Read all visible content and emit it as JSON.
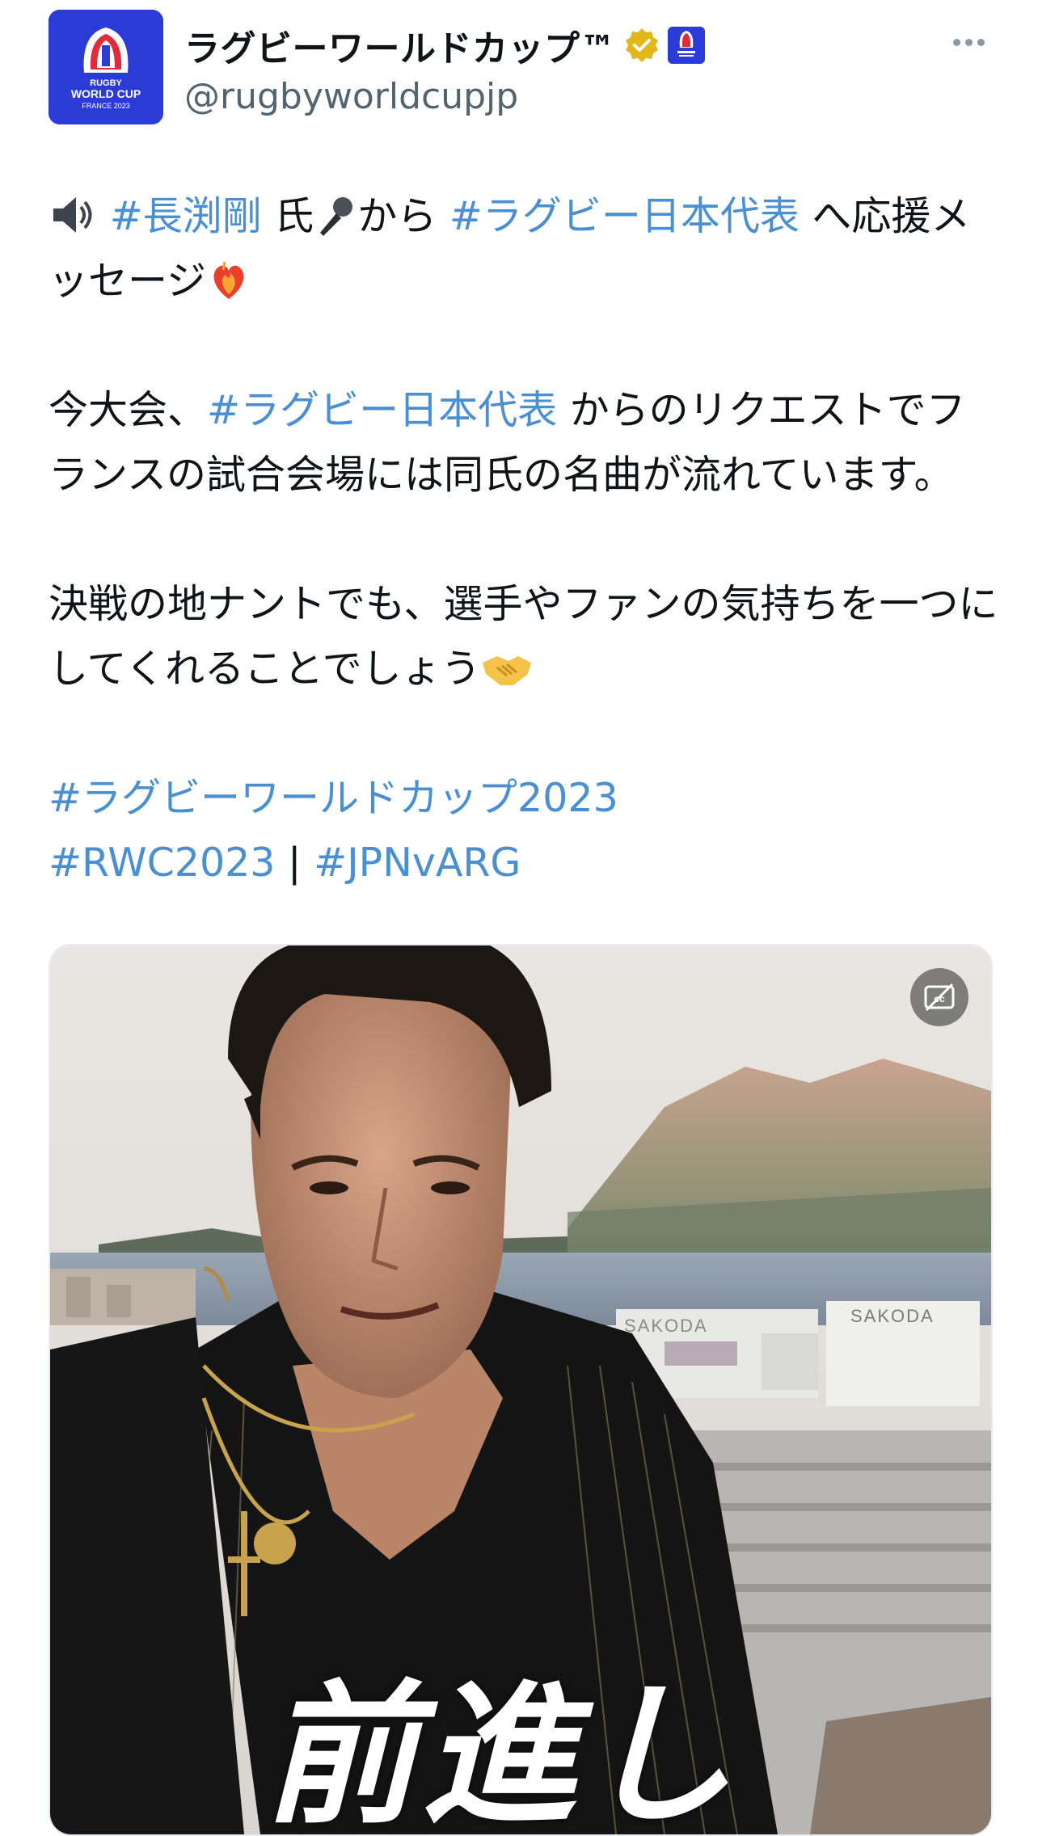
{
  "tweet": {
    "display_name": "ラグビーワールドカップ™",
    "handle": "@rugbyworldcupjp",
    "avatar_text": [
      "RUGBY",
      "WORLD CUP",
      "FRANCE 2023"
    ],
    "brand_color": "#2b3bd6",
    "link_color": "#4a8fd1",
    "paragraph1": {
      "tag1": "#長渕剛",
      "text1": " 氏",
      "text2": "から ",
      "tag2": "#ラグビー日本代表",
      "text3": " へ応援メッセージ"
    },
    "paragraph2": {
      "text1": "今大会、",
      "tag1": "#ラグビー日本代表",
      "text2": " からのリクエストでフランスの試合会場には同氏の名曲が流れています。"
    },
    "paragraph3": {
      "text1": "決戦の地ナントでも、選手やファンの気持ちを一つにしてくれることでしょう"
    },
    "hashtags": {
      "line1": "#ラグビーワールドカップ2023",
      "line2_tag1": "#RWC2023",
      "line2_sep": " | ",
      "line2_tag2": "#JPNvARG"
    },
    "media": {
      "caption": "前進し",
      "sign_left": "SAKODA",
      "sign_right": "SAKODA",
      "cc_icon": "closed-captions-off-icon"
    }
  }
}
